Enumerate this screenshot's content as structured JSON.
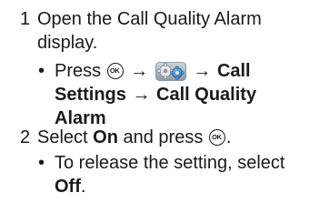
{
  "steps": [
    {
      "number": "1",
      "text_line1": "Open the Call Quality Alarm",
      "text_line2": "display.",
      "bullet": {
        "dot": "•",
        "press": "Press",
        "ok_key": "OK",
        "arrow1": "→",
        "settings_icon": "settings-gear-icon",
        "arrow2": "→",
        "menu1": "Call",
        "menu1b": "Settings",
        "arrow3": "→",
        "menu2a": "Call Quality",
        "menu2b": "Alarm"
      }
    },
    {
      "number": "2",
      "select": "Select",
      "option_on": "On",
      "and_press": "and press",
      "ok_key": "OK",
      "period": ".",
      "bullet": {
        "dot": "•",
        "text": "To release the setting, select",
        "option_off": "Off",
        "period": "."
      }
    }
  ],
  "colors": {
    "text": "#1a1a1a",
    "icon_blue": "#3b82c4",
    "icon_gray": "#9aa4ad"
  }
}
